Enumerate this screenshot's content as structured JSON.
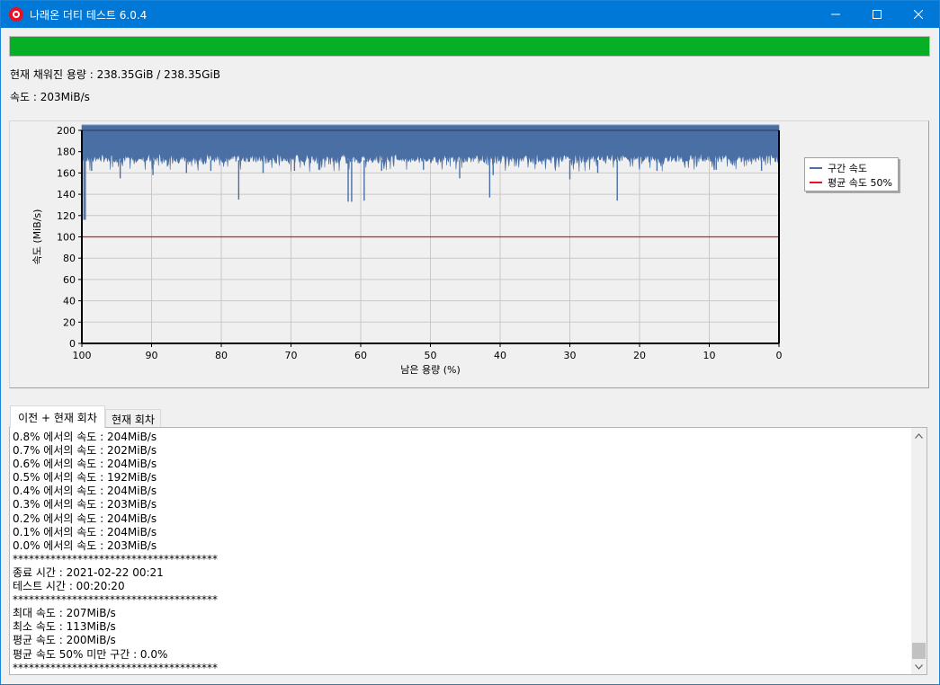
{
  "window": {
    "title": "나래온 더티 테스트 6.0.4"
  },
  "progress": {
    "fraction": 1.0,
    "color": "#06b025"
  },
  "info": {
    "capacity": "현재 채워진 용량 : 238.35GiB / 238.35GiB",
    "speed": "속도 : 203MiB/s"
  },
  "chart_data": {
    "type": "area",
    "xlabel": "남은 용량 (%)",
    "ylabel": "속도 (MiB/s)",
    "xlim": [
      100,
      0
    ],
    "ylim": [
      0,
      200
    ],
    "x_ticks": [
      100,
      90,
      80,
      70,
      60,
      50,
      40,
      30,
      20,
      10,
      0
    ],
    "y_ticks": [
      0,
      20,
      40,
      60,
      80,
      100,
      120,
      140,
      160,
      180,
      200
    ],
    "grid": true,
    "legend_position": "right",
    "series": [
      {
        "name": "구간 속도",
        "color": "#4a6fa5",
        "typical_range": [
          170,
          205
        ],
        "dips": [
          {
            "x": 99.7,
            "y": 116
          },
          {
            "x": 99.5,
            "y": 116
          },
          {
            "x": 98.6,
            "y": 162
          },
          {
            "x": 94.5,
            "y": 155
          },
          {
            "x": 89.8,
            "y": 158
          },
          {
            "x": 85.0,
            "y": 160
          },
          {
            "x": 81.5,
            "y": 162
          },
          {
            "x": 77.5,
            "y": 135
          },
          {
            "x": 74.0,
            "y": 160
          },
          {
            "x": 69.5,
            "y": 162
          },
          {
            "x": 66.0,
            "y": 163
          },
          {
            "x": 61.8,
            "y": 133
          },
          {
            "x": 61.3,
            "y": 133
          },
          {
            "x": 59.5,
            "y": 134
          },
          {
            "x": 57.0,
            "y": 162
          },
          {
            "x": 51.0,
            "y": 163
          },
          {
            "x": 45.8,
            "y": 155
          },
          {
            "x": 41.5,
            "y": 137
          },
          {
            "x": 41.0,
            "y": 158
          },
          {
            "x": 30.0,
            "y": 154
          },
          {
            "x": 26.0,
            "y": 160
          },
          {
            "x": 23.2,
            "y": 134
          },
          {
            "x": 17.5,
            "y": 162
          },
          {
            "x": 9.0,
            "y": 163
          },
          {
            "x": 2.5,
            "y": 162
          }
        ]
      },
      {
        "name": "평균 속도 50%",
        "color": "#e81123",
        "values": [
          100,
          100
        ]
      }
    ]
  },
  "tabs": [
    {
      "label": "이전 + 현재 회차",
      "active": true
    },
    {
      "label": "현재 회차",
      "active": false
    }
  ],
  "log_lines": [
    "0.8% 에서의 속도 : 204MiB/s",
    "0.7% 에서의 속도 : 202MiB/s",
    "0.6% 에서의 속도 : 204MiB/s",
    "0.5% 에서의 속도 : 192MiB/s",
    "0.4% 에서의 속도 : 204MiB/s",
    "0.3% 에서의 속도 : 203MiB/s",
    "0.2% 에서의 속도 : 204MiB/s",
    "0.1% 에서의 속도 : 204MiB/s",
    "0.0% 에서의 속도 : 203MiB/s",
    "**************************************",
    "종료 시간 : 2021-02-22 00:21",
    "테스트 시간 : 00:20:20",
    "**************************************",
    "최대 속도 : 207MiB/s",
    "최소 속도 : 113MiB/s",
    "평균 속도 : 200MiB/s",
    "평균 속도 50% 미만 구간 : 0.0%",
    "**************************************"
  ],
  "icons": {
    "app": "app-icon",
    "minimize": "minimize-icon",
    "maximize": "maximize-icon",
    "close": "close-icon",
    "scroll_up": "chevron-up-icon",
    "scroll_down": "chevron-down-icon"
  }
}
